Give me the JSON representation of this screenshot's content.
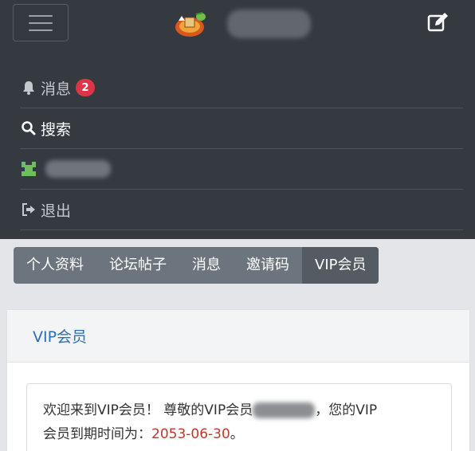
{
  "header": {
    "menu_icon": "hamburger-icon",
    "edit_icon": "edit-icon",
    "logo": "site-logo"
  },
  "nav": {
    "messages": {
      "label": "消息",
      "badge": "2",
      "icon": "bell-icon"
    },
    "search": {
      "label": "搜索",
      "icon": "search-icon"
    },
    "user": {
      "icon": "user-avatar-icon"
    },
    "logout": {
      "label": "退出",
      "icon": "logout-icon"
    }
  },
  "tabs": [
    {
      "label": "个人资料"
    },
    {
      "label": "论坛帖子"
    },
    {
      "label": "消息"
    },
    {
      "label": "邀请码"
    },
    {
      "label": "VIP会员",
      "active": true
    }
  ],
  "card": {
    "title": "VIP会员",
    "welcome_prefix": "欢迎来到VIP会员！ 尊敬的VIP会员",
    "welcome_suffix": "，您的VIP",
    "expire_prefix": "会员到期时间为：",
    "expire_date": "2053-06-30",
    "expire_suffix": "。"
  },
  "colors": {
    "topbar": "#343a40",
    "badge": "#dc3545",
    "tab_bg": "#6c757d",
    "tab_active": "#545b62",
    "title": "#2d6fb5",
    "expire": "#c0392b"
  }
}
